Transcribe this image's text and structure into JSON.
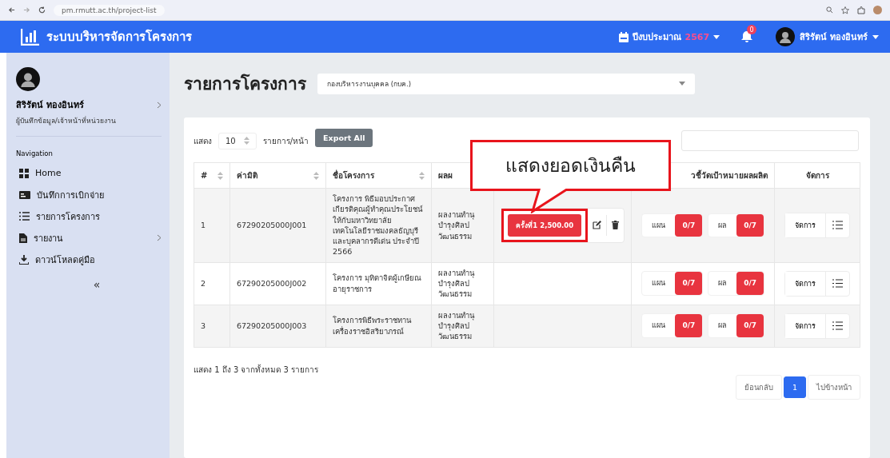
{
  "browser": {
    "url": "pm.rmutt.ac.th/project-list"
  },
  "header": {
    "title": "ระบบบริหารจัดการโครงการ",
    "year_label": "ปีงบประมาณ",
    "year": "2567",
    "notifications": "0",
    "user": "สิริรัตน์ ทองอินทร์"
  },
  "sidebar": {
    "user_name": "สิริรัตน์ ทองอินทร์",
    "user_role": "ผู้บันทึกข้อมูล/เจ้าหน้าที่หน่วยงาน",
    "nav_heading": "Navigation",
    "items": [
      {
        "label": "Home",
        "expandable": false
      },
      {
        "label": "บันทึกการเบิกจ่าย",
        "expandable": false
      },
      {
        "label": "รายการโครงการ",
        "expandable": false
      },
      {
        "label": "รายงาน",
        "expandable": true
      },
      {
        "label": "ดาวน์โหลดคู่มือ",
        "expandable": false
      }
    ],
    "collapse": "«"
  },
  "page": {
    "title": "รายการโครงการ",
    "department": "กองบริหารงานบุคคล (กบค.)"
  },
  "table_controls": {
    "show_label": "แสดง",
    "page_size": "10",
    "per_page_label": "รายการ/หน้า",
    "export_button": "Export All"
  },
  "table": {
    "columns": [
      "#",
      "ค่ามิติ",
      "ชื่อโครงการ",
      "ผลผ",
      "",
      "วชี้วัดเป้าหมายผลผลิต",
      "จัดการ"
    ],
    "rows": [
      {
        "number": "1",
        "code": "67290205000J001",
        "name": "โครงการ พิธีมอบประกาศเกียรติคุณผู้ทำคุณประโยชน์ให้กับมหาวิทยาลัยเทคโนโลยีราชมงคลธัญบุรี และบุคลากรดีเด่น ประจำปี 2566",
        "output": "ผลงานทำนุบำรุงศิลปวัฒนธรรม",
        "refund": "ครั้งที่1  2,500.00",
        "plan_label": "แผน",
        "plan_value": "0/7",
        "result_label": "ผล",
        "result_value": "0/7",
        "manage": "จัดการ"
      },
      {
        "number": "2",
        "code": "67290205000J002",
        "name": "โครงการ มุทิตาจิตผู้เกษียณอายุราชการ",
        "output": "ผลงานทำนุบำรุงศิลปวัฒนธรรม",
        "refund": null,
        "plan_label": "แผน",
        "plan_value": "0/7",
        "result_label": "ผล",
        "result_value": "0/7",
        "manage": "จัดการ"
      },
      {
        "number": "3",
        "code": "67290205000J003",
        "name": "โครงการพิธีพระราชทานเครื่องราชอิสริยาภรณ์",
        "output": "ผลงานทำนุบำรุงศิลปวัฒนธรรม",
        "refund": null,
        "plan_label": "แผน",
        "plan_value": "0/7",
        "result_label": "ผล",
        "result_value": "0/7",
        "manage": "จัดการ"
      }
    ]
  },
  "table_info": "แสดง 1 ถึง 3 จากทั้งหมด 3 รายการ",
  "pagination": {
    "previous": "ย้อนกลับ",
    "pages": [
      {
        "label": "1",
        "selected": true
      }
    ],
    "next": "ไปข้างหน้า"
  },
  "callout": {
    "text": "แสดงยอดเงินคืน"
  }
}
